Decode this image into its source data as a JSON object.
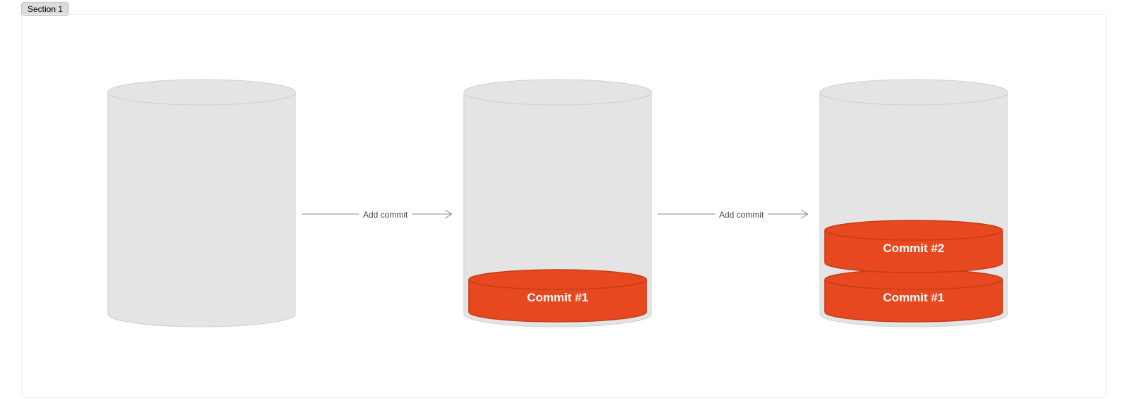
{
  "section_tab": "Section 1",
  "arrows": {
    "a1": "Add commit",
    "a2": "Add commit"
  },
  "commits": {
    "cyl2_bottom": "Commit #1",
    "cyl3_bottom": "Commit #1",
    "cyl3_top": "Commit #2"
  },
  "colors": {
    "cylinder_fill": "#e4e4e4",
    "cylinder_stroke": "#cfcfcf",
    "commit_fill": "#e8481f",
    "commit_stroke": "#c53d19",
    "arrow": "#888888"
  }
}
